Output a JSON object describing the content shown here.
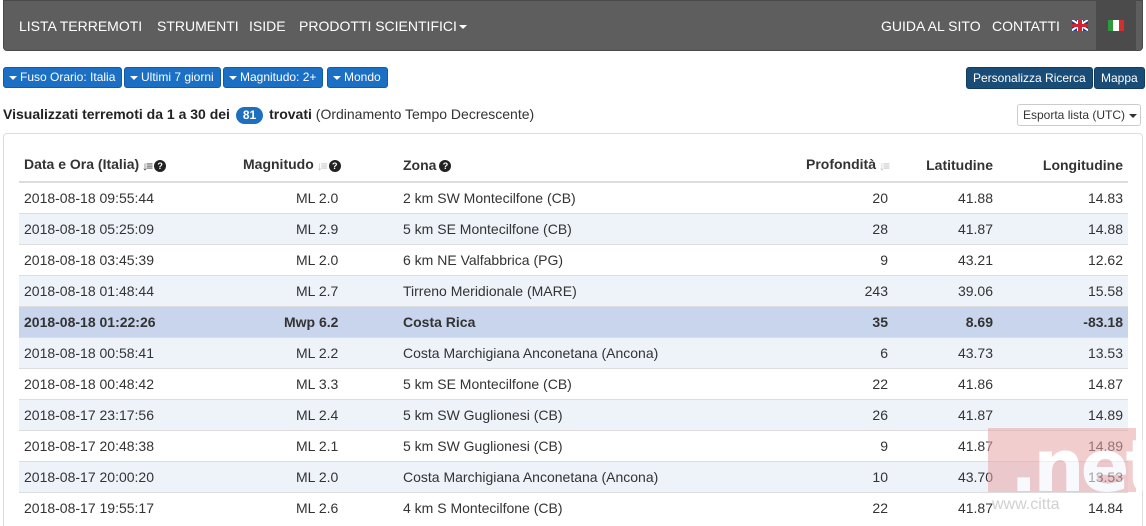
{
  "nav": {
    "left": [
      "LISTA TERREMOTI",
      "STRUMENTI",
      "ISIDE",
      "PRODOTTI SCIENTIFICI"
    ],
    "right": [
      "GUIDA AL SITO",
      "CONTATTI"
    ]
  },
  "filters": [
    "Fuso Orario: Italia",
    "Ultimi 7 giorni",
    "Magnitudo: 2+",
    "Mondo"
  ],
  "actions": {
    "customize": "Personalizza Ricerca",
    "map": "Mappa"
  },
  "summary": {
    "prefix": "Visualizzati terremoti da 1 a 30 dei",
    "count": "81",
    "suffix": "trovati",
    "order": "(Ordinamento Tempo Decrescente)"
  },
  "export_label": "Esporta lista (UTC)",
  "table": {
    "headers": [
      "Data e Ora (Italia)",
      "Magnitudo",
      "Zona",
      "Profondità",
      "Latitudine",
      "Longitudine"
    ],
    "rows": [
      [
        "2018-08-18 09:55:44",
        "ML 2.0",
        "2 km SW Montecilfone (CB)",
        "20",
        "41.88",
        "14.83"
      ],
      [
        "2018-08-18 05:25:09",
        "ML 2.9",
        "5 km SE Montecilfone (CB)",
        "28",
        "41.87",
        "14.88"
      ],
      [
        "2018-08-18 03:45:39",
        "ML 2.0",
        "6 km NE Valfabbrica (PG)",
        "9",
        "43.21",
        "12.62"
      ],
      [
        "2018-08-18 01:48:44",
        "ML 2.7",
        "Tirreno Meridionale (MARE)",
        "243",
        "39.06",
        "15.58"
      ],
      [
        "2018-08-18 01:22:26",
        "Mwp 6.2",
        "Costa Rica",
        "35",
        "8.69",
        "-83.18"
      ],
      [
        "2018-08-18 00:58:41",
        "ML 2.2",
        "Costa Marchigiana Anconetana (Ancona)",
        "6",
        "43.73",
        "13.53"
      ],
      [
        "2018-08-18 00:48:42",
        "ML 3.3",
        "5 km SE Montecilfone (CB)",
        "22",
        "41.86",
        "14.87"
      ],
      [
        "2018-08-17 23:17:56",
        "ML 2.4",
        "5 km SW Guglionesi (CB)",
        "26",
        "41.87",
        "14.89"
      ],
      [
        "2018-08-17 20:48:38",
        "ML 2.1",
        "5 km SW Guglionesi (CB)",
        "9",
        "41.87",
        "14.89"
      ],
      [
        "2018-08-17 20:00:20",
        "ML 2.0",
        "Costa Marchigiana Anconetana (Ancona)",
        "10",
        "43.70",
        "13.53"
      ],
      [
        "2018-08-17 19:55:17",
        "ML 2.6",
        "4 km S Montecilfone (CB)",
        "22",
        "41.87",
        "14.84"
      ]
    ],
    "highlight_row": 4
  },
  "watermark": {
    "text": ".net",
    "url": "www.citta"
  },
  "colors": {
    "navbar": "#5e5e5e",
    "filter_button": "#1b6fc4",
    "action_button": "#194d78",
    "highlight_row": "#c9d5ec",
    "stripe_row": "#eef2f9"
  }
}
